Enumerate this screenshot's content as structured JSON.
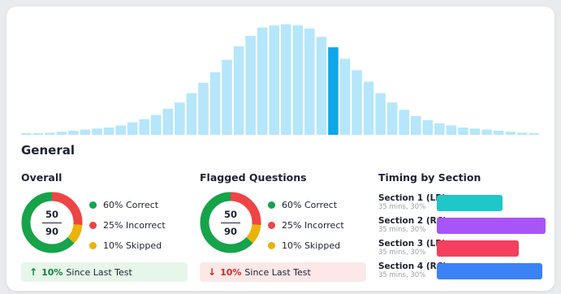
{
  "chart_data": {
    "type": "bar",
    "values": [
      1,
      1,
      2,
      3,
      4,
      5,
      6,
      7,
      9,
      12,
      15,
      19,
      25,
      31,
      40,
      50,
      60,
      72,
      85,
      95,
      103,
      105,
      106,
      105,
      102,
      94,
      84,
      73,
      62,
      51,
      40,
      31,
      24,
      18,
      14,
      11,
      9,
      7,
      6,
      5,
      4,
      3,
      2,
      1
    ],
    "highlight_index": 26,
    "colors": {
      "default": "#b5e6fb",
      "highlight": "#0ea5e9"
    },
    "grid": false,
    "title": "",
    "xlabel": "",
    "ylabel": ""
  },
  "general": {
    "title": "General"
  },
  "overall": {
    "title": "Overall",
    "fraction": {
      "numerator": "50",
      "denominator": "90"
    },
    "legend": [
      {
        "label": "60% Correct",
        "color": "#16a34a",
        "value": 60
      },
      {
        "label": "25% Incorrect",
        "color": "#ef4444",
        "value": 25
      },
      {
        "label": "10% Skipped",
        "color": "#eab308",
        "value": 10
      }
    ],
    "change": {
      "arrow": "↑",
      "value": "10%",
      "text": "Since Last Test",
      "color": "#15803d",
      "bg": "#e6f6e9"
    }
  },
  "flagged": {
    "title": "Flagged Questions",
    "fraction": {
      "numerator": "50",
      "denominator": "90"
    },
    "legend": [
      {
        "label": "60% Correct",
        "color": "#16a34a",
        "value": 60
      },
      {
        "label": "25% Incorrect",
        "color": "#ef4444",
        "value": 25
      },
      {
        "label": "10% Skipped",
        "color": "#eab308",
        "value": 10
      }
    ],
    "change": {
      "arrow": "↓",
      "value": "10%",
      "text": "Since Last Test",
      "color": "#dc2626",
      "bg": "#fde8e8"
    }
  },
  "timing": {
    "title": "Timing by Section",
    "rows": [
      {
        "name": "Section 1 (LR)",
        "sub": "35 mins, 30%",
        "color": "#1ec8c8",
        "fraction": 0.6
      },
      {
        "name": "Section 2 (RC)",
        "sub": "35 mins, 30%",
        "color": "#a855f7",
        "fraction": 0.99
      },
      {
        "name": "Section 3 (LR)",
        "sub": "35 mins, 30%",
        "color": "#f43f5e",
        "fraction": 0.75
      },
      {
        "name": "Section 4 (RC)",
        "sub": "35 mins, 30%",
        "color": "#3b82f6",
        "fraction": 0.96
      }
    ]
  }
}
